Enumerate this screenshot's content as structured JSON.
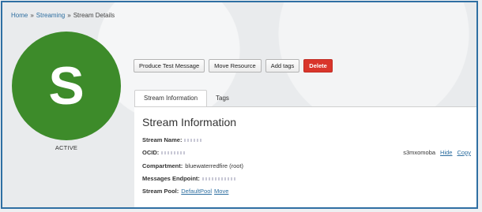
{
  "breadcrumb": {
    "home": "Home",
    "sep1": "»",
    "streaming": "Streaming",
    "sep2": "»",
    "current": "Stream Details"
  },
  "avatar": {
    "letter": "S",
    "color": "#3d8b2a"
  },
  "status": "ACTIVE",
  "actions": {
    "produce": "Produce Test Message",
    "move": "Move Resource",
    "tags": "Add tags",
    "delete": "Delete"
  },
  "tabs": [
    {
      "label": "Stream Information",
      "active": true
    },
    {
      "label": "Tags",
      "active": false
    }
  ],
  "info": {
    "title": "Stream Information",
    "stream_name_label": "Stream Name:",
    "ocid_label": "OCID:",
    "ocid_suffix": "s3mxomoba",
    "hide": "Hide",
    "copy": "Copy",
    "compartment_label": "Compartment:",
    "compartment_value": "bluewaterredfire (root)",
    "endpoint_label": "Messages Endpoint:",
    "pool_label": "Stream Pool:",
    "pool_value": "DefaultPool",
    "pool_move": "Move"
  },
  "colors": {
    "delete": "#d9352b",
    "link": "#2d6ea0",
    "highlight": "#f7f128"
  }
}
